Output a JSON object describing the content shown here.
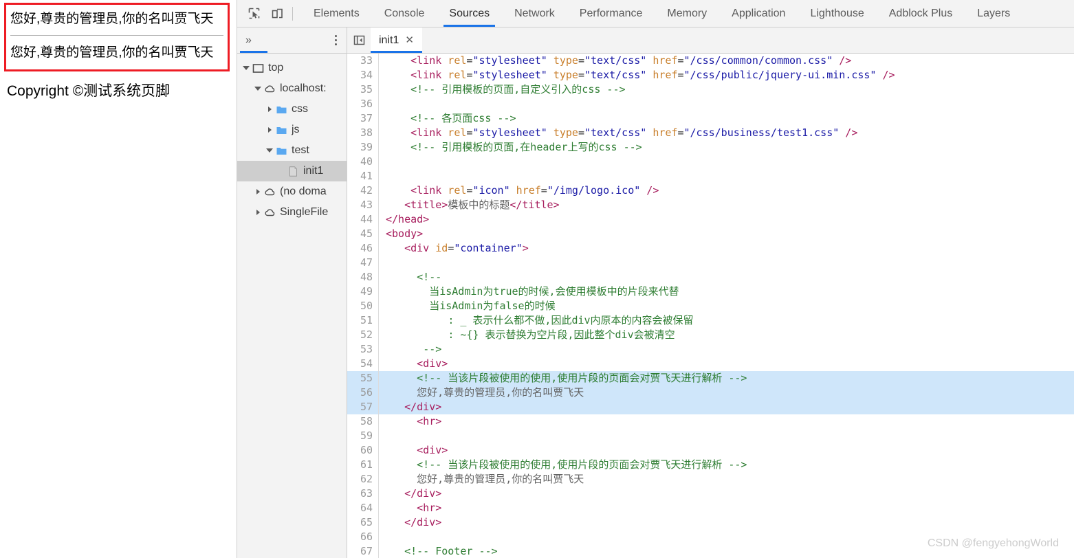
{
  "rendered_page": {
    "admin_block": {
      "border_color": "#ee1c24",
      "lines": [
        "您好,尊贵的管理员,你的名叫贾飞天",
        "您好,尊贵的管理员,你的名叫贾飞天"
      ]
    },
    "footer": "Copyright ©测试系统页脚"
  },
  "devtools": {
    "toolbar": {
      "inspect_icon": "inspect-element-icon",
      "device_icon": "device-toolbar-icon",
      "tabs": [
        {
          "label": "Elements",
          "active": false
        },
        {
          "label": "Console",
          "active": false
        },
        {
          "label": "Sources",
          "active": true
        },
        {
          "label": "Network",
          "active": false
        },
        {
          "label": "Performance",
          "active": false
        },
        {
          "label": "Memory",
          "active": false
        },
        {
          "label": "Application",
          "active": false
        },
        {
          "label": "Lighthouse",
          "active": false
        },
        {
          "label": "Adblock Plus",
          "active": false
        },
        {
          "label": "Layers",
          "active": false
        }
      ]
    },
    "navigator": {
      "overflow_label": "»",
      "more_options_icon": "kebab-menu-icon",
      "tree": [
        {
          "label": "top",
          "icon": "frame-icon",
          "depth": 0,
          "twisty": "open",
          "selected": false
        },
        {
          "label": "localhost:",
          "icon": "cloud-icon",
          "depth": 1,
          "twisty": "open",
          "selected": false
        },
        {
          "label": "css",
          "icon": "folder-icon",
          "depth": 2,
          "twisty": "closed",
          "selected": false
        },
        {
          "label": "js",
          "icon": "folder-icon",
          "depth": 2,
          "twisty": "closed",
          "selected": false
        },
        {
          "label": "test",
          "icon": "folder-icon",
          "depth": 2,
          "twisty": "open",
          "selected": false
        },
        {
          "label": "init1",
          "icon": "file-icon",
          "depth": 3,
          "twisty": "none",
          "selected": true
        },
        {
          "label": "(no doma",
          "icon": "cloud-icon",
          "depth": 1,
          "twisty": "closed",
          "selected": false
        },
        {
          "label": "SingleFile",
          "icon": "cloud-icon",
          "depth": 1,
          "twisty": "closed",
          "selected": false
        }
      ]
    },
    "editor": {
      "panel_toggle_icon": "show-navigator-icon",
      "file_tab": "init1",
      "close_icon": "✕",
      "selection_color": "#cfe6fa",
      "lines": [
        {
          "n": 33,
          "hl": false,
          "tokens": [
            {
              "t": "plain",
              "v": "    "
            },
            {
              "t": "tag",
              "v": "<link"
            },
            {
              "t": "attr",
              "v": " rel"
            },
            {
              "t": "plain",
              "v": "="
            },
            {
              "t": "str",
              "v": "\"stylesheet\""
            },
            {
              "t": "attr",
              "v": " type"
            },
            {
              "t": "plain",
              "v": "="
            },
            {
              "t": "str",
              "v": "\"text/css\""
            },
            {
              "t": "attr",
              "v": " href"
            },
            {
              "t": "plain",
              "v": "="
            },
            {
              "t": "str",
              "v": "\"/css/common/common.css\""
            },
            {
              "t": "tag",
              "v": " />"
            }
          ]
        },
        {
          "n": 34,
          "hl": false,
          "tokens": [
            {
              "t": "plain",
              "v": "    "
            },
            {
              "t": "tag",
              "v": "<link"
            },
            {
              "t": "attr",
              "v": " rel"
            },
            {
              "t": "plain",
              "v": "="
            },
            {
              "t": "str",
              "v": "\"stylesheet\""
            },
            {
              "t": "attr",
              "v": " type"
            },
            {
              "t": "plain",
              "v": "="
            },
            {
              "t": "str",
              "v": "\"text/css\""
            },
            {
              "t": "attr",
              "v": " href"
            },
            {
              "t": "plain",
              "v": "="
            },
            {
              "t": "str",
              "v": "\"/css/public/jquery-ui.min.css\""
            },
            {
              "t": "tag",
              "v": " />"
            }
          ]
        },
        {
          "n": 35,
          "hl": false,
          "tokens": [
            {
              "t": "plain",
              "v": "    "
            },
            {
              "t": "cmt",
              "v": "<!-- 引用模板的页面,自定义引入的css -->"
            }
          ]
        },
        {
          "n": 36,
          "hl": false,
          "tokens": []
        },
        {
          "n": 37,
          "hl": false,
          "tokens": [
            {
              "t": "plain",
              "v": "    "
            },
            {
              "t": "cmt",
              "v": "<!-- 各页面css -->"
            }
          ]
        },
        {
          "n": 38,
          "hl": false,
          "tokens": [
            {
              "t": "plain",
              "v": "    "
            },
            {
              "t": "tag",
              "v": "<link"
            },
            {
              "t": "attr",
              "v": " rel"
            },
            {
              "t": "plain",
              "v": "="
            },
            {
              "t": "str",
              "v": "\"stylesheet\""
            },
            {
              "t": "attr",
              "v": " type"
            },
            {
              "t": "plain",
              "v": "="
            },
            {
              "t": "str",
              "v": "\"text/css\""
            },
            {
              "t": "attr",
              "v": " href"
            },
            {
              "t": "plain",
              "v": "="
            },
            {
              "t": "str",
              "v": "\"/css/business/test1.css\""
            },
            {
              "t": "tag",
              "v": " />"
            }
          ]
        },
        {
          "n": 39,
          "hl": false,
          "tokens": [
            {
              "t": "plain",
              "v": "    "
            },
            {
              "t": "cmt",
              "v": "<!-- 引用模板的页面,在header上写的css -->"
            }
          ]
        },
        {
          "n": 40,
          "hl": false,
          "tokens": []
        },
        {
          "n": 41,
          "hl": false,
          "tokens": []
        },
        {
          "n": 42,
          "hl": false,
          "tokens": [
            {
              "t": "plain",
              "v": "    "
            },
            {
              "t": "tag",
              "v": "<link"
            },
            {
              "t": "attr",
              "v": " rel"
            },
            {
              "t": "plain",
              "v": "="
            },
            {
              "t": "str",
              "v": "\"icon\""
            },
            {
              "t": "attr",
              "v": " href"
            },
            {
              "t": "plain",
              "v": "="
            },
            {
              "t": "str",
              "v": "\"/img/logo.ico\""
            },
            {
              "t": "tag",
              "v": " />"
            }
          ]
        },
        {
          "n": 43,
          "hl": false,
          "tokens": [
            {
              "t": "plain",
              "v": "   "
            },
            {
              "t": "tag",
              "v": "<title>"
            },
            {
              "t": "txt",
              "v": "模板中的标题"
            },
            {
              "t": "tag",
              "v": "</title>"
            }
          ]
        },
        {
          "n": 44,
          "hl": false,
          "tokens": [
            {
              "t": "tag",
              "v": "</head>"
            }
          ]
        },
        {
          "n": 45,
          "hl": false,
          "tokens": [
            {
              "t": "tag",
              "v": "<body>"
            }
          ]
        },
        {
          "n": 46,
          "hl": false,
          "tokens": [
            {
              "t": "plain",
              "v": "   "
            },
            {
              "t": "tag",
              "v": "<div"
            },
            {
              "t": "attr",
              "v": " id"
            },
            {
              "t": "plain",
              "v": "="
            },
            {
              "t": "str",
              "v": "\"container\""
            },
            {
              "t": "tag",
              "v": ">"
            }
          ]
        },
        {
          "n": 47,
          "hl": false,
          "tokens": []
        },
        {
          "n": 48,
          "hl": false,
          "tokens": [
            {
              "t": "plain",
              "v": "     "
            },
            {
              "t": "cmt",
              "v": "<!--"
            }
          ]
        },
        {
          "n": 49,
          "hl": false,
          "tokens": [
            {
              "t": "plain",
              "v": "       "
            },
            {
              "t": "cmt",
              "v": "当isAdmin为true的时候,会使用模板中的片段来代替"
            }
          ]
        },
        {
          "n": 50,
          "hl": false,
          "tokens": [
            {
              "t": "plain",
              "v": "       "
            },
            {
              "t": "cmt",
              "v": "当isAdmin为false的时候"
            }
          ]
        },
        {
          "n": 51,
          "hl": false,
          "tokens": [
            {
              "t": "plain",
              "v": "          "
            },
            {
              "t": "cmt",
              "v": ": _ 表示什么都不做,因此div内原本的内容会被保留"
            }
          ]
        },
        {
          "n": 52,
          "hl": false,
          "tokens": [
            {
              "t": "plain",
              "v": "          "
            },
            {
              "t": "cmt",
              "v": ": ~{} 表示替换为空片段,因此整个div会被清空"
            }
          ]
        },
        {
          "n": 53,
          "hl": false,
          "tokens": [
            {
              "t": "plain",
              "v": "      "
            },
            {
              "t": "cmt",
              "v": "-->"
            }
          ]
        },
        {
          "n": 54,
          "hl": false,
          "tokens": [
            {
              "t": "plain",
              "v": "     "
            },
            {
              "t": "tag",
              "v": "<div>"
            }
          ]
        },
        {
          "n": 55,
          "hl": true,
          "tokens": [
            {
              "t": "plain",
              "v": "     "
            },
            {
              "t": "cmt",
              "v": "<!-- 当该片段被使用的使用,使用片段的页面会对贾飞天进行解析 -->"
            }
          ]
        },
        {
          "n": 56,
          "hl": true,
          "tokens": [
            {
              "t": "plain",
              "v": "     "
            },
            {
              "t": "txt",
              "v": "您好,尊贵的管理员,你的名叫贾飞天"
            }
          ]
        },
        {
          "n": 57,
          "hl": true,
          "tokens": [
            {
              "t": "plain",
              "v": "   "
            },
            {
              "t": "tag",
              "v": "</div>"
            }
          ]
        },
        {
          "n": 58,
          "hl": false,
          "tokens": [
            {
              "t": "plain",
              "v": "     "
            },
            {
              "t": "tag",
              "v": "<hr>"
            }
          ]
        },
        {
          "n": 59,
          "hl": false,
          "tokens": []
        },
        {
          "n": 60,
          "hl": false,
          "tokens": [
            {
              "t": "plain",
              "v": "     "
            },
            {
              "t": "tag",
              "v": "<div>"
            }
          ]
        },
        {
          "n": 61,
          "hl": false,
          "tokens": [
            {
              "t": "plain",
              "v": "     "
            },
            {
              "t": "cmt",
              "v": "<!-- 当该片段被使用的使用,使用片段的页面会对贾飞天进行解析 -->"
            }
          ]
        },
        {
          "n": 62,
          "hl": false,
          "tokens": [
            {
              "t": "plain",
              "v": "     "
            },
            {
              "t": "txt",
              "v": "您好,尊贵的管理员,你的名叫贾飞天"
            }
          ]
        },
        {
          "n": 63,
          "hl": false,
          "tokens": [
            {
              "t": "plain",
              "v": "   "
            },
            {
              "t": "tag",
              "v": "</div>"
            }
          ]
        },
        {
          "n": 64,
          "hl": false,
          "tokens": [
            {
              "t": "plain",
              "v": "     "
            },
            {
              "t": "tag",
              "v": "<hr>"
            }
          ]
        },
        {
          "n": 65,
          "hl": false,
          "tokens": [
            {
              "t": "plain",
              "v": "   "
            },
            {
              "t": "tag",
              "v": "</div>"
            }
          ]
        },
        {
          "n": 66,
          "hl": false,
          "tokens": []
        },
        {
          "n": 67,
          "hl": false,
          "tokens": [
            {
              "t": "plain",
              "v": "   "
            },
            {
              "t": "cmt",
              "v": "<!-- Footer -->"
            }
          ]
        }
      ]
    }
  },
  "watermark": "CSDN @fengyehongWorld"
}
